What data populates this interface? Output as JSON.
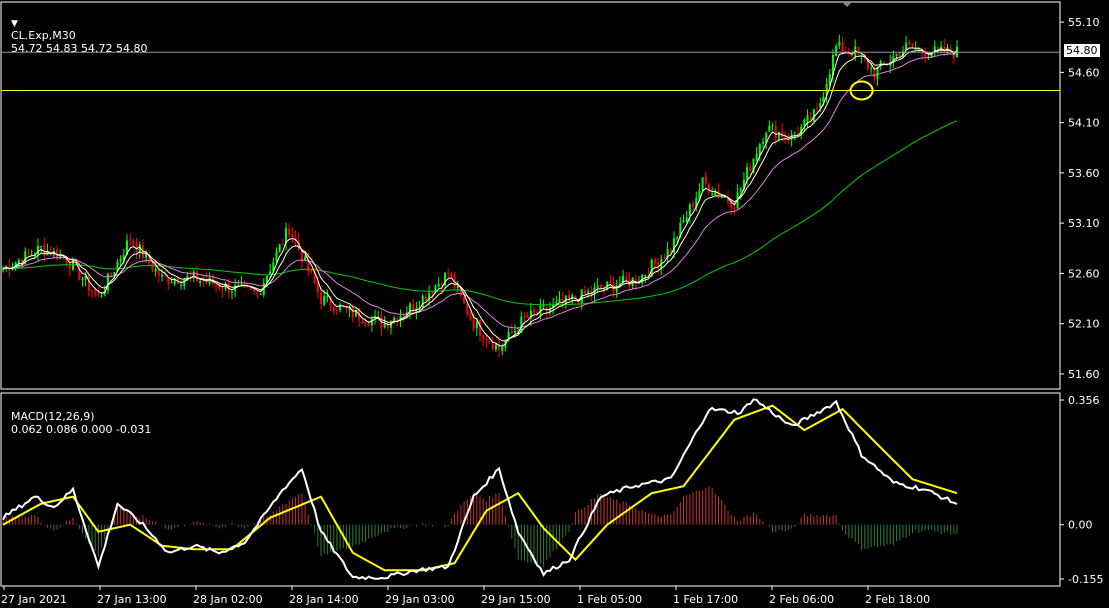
{
  "header": {
    "symbol": "CL.Exp,M30",
    "ohlc": "54.72 54.83 54.72 54.80"
  },
  "macd_header": {
    "label": "MACD(12,26,9)",
    "values": "0.062 0.086 0.000 -0.031"
  },
  "current_price": "54.80",
  "colors": {
    "background": "#000000",
    "bull": "#00ff00",
    "bear": "#ff0000",
    "ma_fast": "#ffffff",
    "ma_mid": "#ffffcc",
    "ma_slow": "#e080e0",
    "ma_long": "#00cc00",
    "hline": "#ffff00",
    "macd_main": "#ffffff",
    "macd_signal": "#ffff00",
    "hist_pos": "#c83232",
    "hist_neg": "#2e7d2e"
  },
  "chart_data": [
    {
      "type": "candlestick",
      "panel": "price",
      "y_ticks": [
        "55.10",
        "54.60",
        "54.10",
        "53.60",
        "53.10",
        "52.60",
        "52.10",
        "51.60"
      ],
      "ylim": [
        51.45,
        55.3
      ],
      "horizontal_line": 54.42,
      "x_tick_labels": [
        "27 Jan 2021",
        "27 Jan 13:00",
        "28 Jan 02:00",
        "28 Jan 14:00",
        "29 Jan 03:00",
        "29 Jan 15:00",
        "1 Feb 05:00",
        "1 Feb 17:00",
        "2 Feb 06:00",
        "2 Feb 18:00"
      ],
      "close_anchors": [
        [
          0,
          52.65
        ],
        [
          12,
          52.85
        ],
        [
          20,
          52.75
        ],
        [
          30,
          52.35
        ],
        [
          40,
          52.95
        ],
        [
          50,
          52.55
        ],
        [
          60,
          52.55
        ],
        [
          72,
          52.45
        ],
        [
          80,
          52.4
        ],
        [
          90,
          53.05
        ],
        [
          100,
          52.35
        ],
        [
          110,
          52.2
        ],
        [
          120,
          52.1
        ],
        [
          130,
          52.3
        ],
        [
          140,
          52.6
        ],
        [
          148,
          52.1
        ],
        [
          156,
          51.85
        ],
        [
          164,
          52.15
        ],
        [
          176,
          52.3
        ],
        [
          188,
          52.45
        ],
        [
          200,
          52.55
        ],
        [
          210,
          52.85
        ],
        [
          220,
          53.5
        ],
        [
          230,
          53.3
        ],
        [
          240,
          54.05
        ],
        [
          248,
          53.95
        ],
        [
          256,
          54.2
        ],
        [
          262,
          54.85
        ],
        [
          268,
          54.8
        ],
        [
          274,
          54.6
        ],
        [
          284,
          54.85
        ],
        [
          292,
          54.8
        ],
        [
          300,
          54.8
        ]
      ]
    },
    {
      "type": "macd",
      "panel": "macd",
      "y_ticks": [
        "0.356",
        "0.00",
        "-0.155"
      ],
      "ylim": [
        -0.175,
        0.376
      ],
      "main_anchors": [
        [
          0,
          0.02
        ],
        [
          10,
          0.08
        ],
        [
          16,
          0.05
        ],
        [
          22,
          0.1
        ],
        [
          30,
          -0.12
        ],
        [
          36,
          0.06
        ],
        [
          44,
          0.0
        ],
        [
          52,
          -0.08
        ],
        [
          60,
          -0.06
        ],
        [
          68,
          -0.08
        ],
        [
          76,
          -0.05
        ],
        [
          88,
          0.1
        ],
        [
          94,
          0.16
        ],
        [
          100,
          -0.02
        ],
        [
          110,
          -0.15
        ],
        [
          120,
          -0.15
        ],
        [
          130,
          -0.13
        ],
        [
          140,
          -0.12
        ],
        [
          148,
          0.08
        ],
        [
          156,
          0.16
        ],
        [
          162,
          -0.02
        ],
        [
          170,
          -0.14
        ],
        [
          178,
          -0.1
        ],
        [
          188,
          0.08
        ],
        [
          198,
          0.11
        ],
        [
          210,
          0.13
        ],
        [
          222,
          0.33
        ],
        [
          232,
          0.32
        ],
        [
          236,
          0.36
        ],
        [
          248,
          0.28
        ],
        [
          262,
          0.35
        ],
        [
          270,
          0.2
        ],
        [
          280,
          0.12
        ],
        [
          290,
          0.1
        ],
        [
          300,
          0.06
        ]
      ],
      "signal_anchors": [
        [
          0,
          0.0
        ],
        [
          12,
          0.06
        ],
        [
          22,
          0.08
        ],
        [
          30,
          -0.02
        ],
        [
          40,
          0.0
        ],
        [
          50,
          -0.06
        ],
        [
          60,
          -0.07
        ],
        [
          72,
          -0.07
        ],
        [
          84,
          0.02
        ],
        [
          100,
          0.08
        ],
        [
          110,
          -0.08
        ],
        [
          120,
          -0.13
        ],
        [
          132,
          -0.13
        ],
        [
          142,
          -0.11
        ],
        [
          152,
          0.04
        ],
        [
          162,
          0.09
        ],
        [
          170,
          -0.01
        ],
        [
          180,
          -0.1
        ],
        [
          190,
          0.0
        ],
        [
          204,
          0.09
        ],
        [
          214,
          0.11
        ],
        [
          230,
          0.3
        ],
        [
          242,
          0.34
        ],
        [
          252,
          0.27
        ],
        [
          264,
          0.33
        ],
        [
          276,
          0.22
        ],
        [
          286,
          0.13
        ],
        [
          300,
          0.09
        ]
      ]
    }
  ]
}
